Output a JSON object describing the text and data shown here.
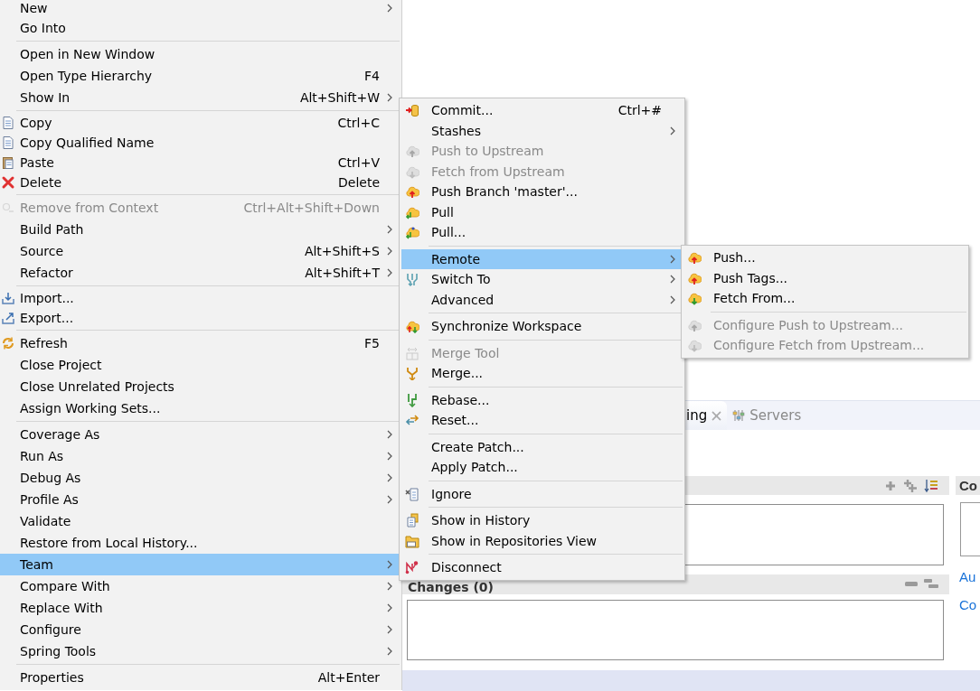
{
  "context_menu": {
    "groups": [
      [
        {
          "label": "New",
          "has_submenu": true,
          "disabled": false,
          "selected": false
        },
        {
          "label": "Go Into",
          "has_submenu": false,
          "disabled": false,
          "selected": false
        }
      ],
      [
        {
          "label": "Open in New Window",
          "has_submenu": false,
          "disabled": false,
          "selected": false
        },
        {
          "label": "Open Type Hierarchy",
          "shortcut": "F4",
          "has_submenu": false,
          "disabled": false,
          "selected": false
        },
        {
          "label": "Show In",
          "shortcut": "Alt+Shift+W",
          "has_submenu": true,
          "disabled": false,
          "selected": false
        }
      ],
      [
        {
          "label": "Copy",
          "shortcut": "Ctrl+C",
          "has_submenu": false,
          "disabled": false,
          "selected": false
        },
        {
          "label": "Copy Qualified Name",
          "has_submenu": false,
          "disabled": false,
          "selected": false
        },
        {
          "label": "Paste",
          "shortcut": "Ctrl+V",
          "has_submenu": false,
          "disabled": false,
          "selected": false
        },
        {
          "label": "Delete",
          "shortcut": "Delete",
          "has_submenu": false,
          "disabled": false,
          "selected": false
        }
      ],
      [
        {
          "label": "Remove from Context",
          "shortcut": "Ctrl+Alt+Shift+Down",
          "has_submenu": false,
          "disabled": true,
          "selected": false
        },
        {
          "label": "Build Path",
          "has_submenu": true,
          "disabled": false,
          "selected": false
        },
        {
          "label": "Source",
          "shortcut": "Alt+Shift+S",
          "has_submenu": true,
          "disabled": false,
          "selected": false
        },
        {
          "label": "Refactor",
          "shortcut": "Alt+Shift+T",
          "has_submenu": true,
          "disabled": false,
          "selected": false
        }
      ],
      [
        {
          "label": "Import...",
          "has_submenu": false,
          "disabled": false,
          "selected": false
        },
        {
          "label": "Export...",
          "has_submenu": false,
          "disabled": false,
          "selected": false
        }
      ],
      [
        {
          "label": "Refresh",
          "shortcut": "F5",
          "has_submenu": false,
          "disabled": false,
          "selected": false
        },
        {
          "label": "Close Project",
          "has_submenu": false,
          "disabled": false,
          "selected": false
        },
        {
          "label": "Close Unrelated Projects",
          "has_submenu": false,
          "disabled": false,
          "selected": false
        },
        {
          "label": "Assign Working Sets...",
          "has_submenu": false,
          "disabled": false,
          "selected": false
        }
      ],
      [
        {
          "label": "Coverage As",
          "has_submenu": true,
          "disabled": false,
          "selected": false
        },
        {
          "label": "Run As",
          "has_submenu": true,
          "disabled": false,
          "selected": false
        },
        {
          "label": "Debug As",
          "has_submenu": true,
          "disabled": false,
          "selected": false
        },
        {
          "label": "Profile As",
          "has_submenu": true,
          "disabled": false,
          "selected": false
        },
        {
          "label": "Validate",
          "has_submenu": false,
          "disabled": false,
          "selected": false
        },
        {
          "label": "Restore from Local History...",
          "has_submenu": false,
          "disabled": false,
          "selected": false
        },
        {
          "label": "Team",
          "has_submenu": true,
          "disabled": false,
          "selected": true
        },
        {
          "label": "Compare With",
          "has_submenu": true,
          "disabled": false,
          "selected": false
        },
        {
          "label": "Replace With",
          "has_submenu": true,
          "disabled": false,
          "selected": false
        },
        {
          "label": "Configure",
          "has_submenu": true,
          "disabled": false,
          "selected": false
        },
        {
          "label": "Spring Tools",
          "has_submenu": true,
          "disabled": false,
          "selected": false
        }
      ],
      [
        {
          "label": "Properties",
          "shortcut": "Alt+Enter",
          "has_submenu": false,
          "disabled": false,
          "selected": false
        }
      ]
    ]
  },
  "team_submenu": {
    "groups": [
      [
        {
          "label": "Commit...",
          "shortcut": "Ctrl+#",
          "has_submenu": false,
          "disabled": false,
          "selected": false
        },
        {
          "label": "Stashes",
          "has_submenu": true,
          "disabled": false,
          "selected": false
        },
        {
          "label": "Push to Upstream",
          "has_submenu": false,
          "disabled": true,
          "selected": false
        },
        {
          "label": "Fetch from Upstream",
          "has_submenu": false,
          "disabled": true,
          "selected": false
        },
        {
          "label": "Push Branch 'master'...",
          "has_submenu": false,
          "disabled": false,
          "selected": false
        },
        {
          "label": "Pull",
          "has_submenu": false,
          "disabled": false,
          "selected": false
        },
        {
          "label": "Pull...",
          "has_submenu": false,
          "disabled": false,
          "selected": false
        }
      ],
      [
        {
          "label": "Remote",
          "has_submenu": true,
          "disabled": false,
          "selected": true
        },
        {
          "label": "Switch To",
          "has_submenu": true,
          "disabled": false,
          "selected": false
        },
        {
          "label": "Advanced",
          "has_submenu": true,
          "disabled": false,
          "selected": false
        }
      ],
      [
        {
          "label": "Synchronize Workspace",
          "has_submenu": false,
          "disabled": false,
          "selected": false
        }
      ],
      [
        {
          "label": "Merge Tool",
          "has_submenu": false,
          "disabled": true,
          "selected": false
        },
        {
          "label": "Merge...",
          "has_submenu": false,
          "disabled": false,
          "selected": false
        }
      ],
      [
        {
          "label": "Rebase...",
          "has_submenu": false,
          "disabled": false,
          "selected": false
        },
        {
          "label": "Reset...",
          "has_submenu": false,
          "disabled": false,
          "selected": false
        }
      ],
      [
        {
          "label": "Create Patch...",
          "has_submenu": false,
          "disabled": false,
          "selected": false
        },
        {
          "label": "Apply Patch...",
          "has_submenu": false,
          "disabled": false,
          "selected": false
        }
      ],
      [
        {
          "label": "Ignore",
          "has_submenu": false,
          "disabled": false,
          "selected": false
        }
      ],
      [
        {
          "label": "Show in History",
          "has_submenu": false,
          "disabled": false,
          "selected": false
        },
        {
          "label": "Show in Repositories View",
          "has_submenu": false,
          "disabled": false,
          "selected": false
        }
      ],
      [
        {
          "label": "Disconnect",
          "has_submenu": false,
          "disabled": false,
          "selected": false
        }
      ]
    ]
  },
  "remote_submenu": {
    "groups": [
      [
        {
          "label": "Push...",
          "has_submenu": false,
          "disabled": false,
          "selected": false
        },
        {
          "label": "Push Tags...",
          "has_submenu": false,
          "disabled": false,
          "selected": false
        },
        {
          "label": "Fetch From...",
          "has_submenu": false,
          "disabled": false,
          "selected": false
        }
      ],
      [
        {
          "label": "Configure Push to Upstream...",
          "has_submenu": false,
          "disabled": true,
          "selected": false
        },
        {
          "label": "Configure Fetch from Upstream...",
          "has_submenu": false,
          "disabled": true,
          "selected": false
        }
      ]
    ]
  },
  "view_tabs": [
    {
      "label": "ing",
      "selected": true,
      "closable": true
    },
    {
      "label": "Servers",
      "selected": false,
      "closable": false
    }
  ],
  "sections": [
    {
      "kind": "list"
    },
    {
      "kind": "changes",
      "title": "Changes (0)"
    }
  ],
  "side_panel": {
    "title": "Co",
    "links": [
      "Au",
      "Co"
    ]
  }
}
